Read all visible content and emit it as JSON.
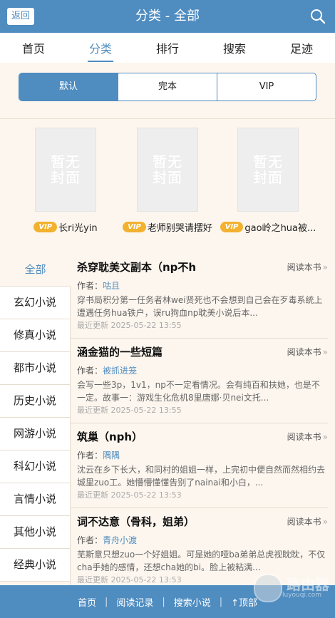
{
  "header": {
    "back_label": "返回",
    "title": "分类 - 全部"
  },
  "nav": {
    "items": [
      "首页",
      "分类",
      "排行",
      "搜索",
      "足迹"
    ],
    "active_index": 1
  },
  "filters": {
    "items": [
      "默认",
      "完本",
      "VIP"
    ],
    "active_index": 0
  },
  "featured": [
    {
      "vip": "VIP",
      "cover_text": [
        "暂无",
        "封面"
      ],
      "title": "长ri光yin"
    },
    {
      "vip": "VIP",
      "cover_text": [
        "暂无",
        "封面"
      ],
      "title": "老师别哭请摆好"
    },
    {
      "vip": "VIP",
      "cover_text": [
        "暂无",
        "封面"
      ],
      "title": "gao岭之hua被..."
    }
  ],
  "categories": {
    "items": [
      "全部",
      "玄幻小说",
      "修真小说",
      "都市小说",
      "历史小说",
      "网游小说",
      "科幻小说",
      "言情小说",
      "其他小说",
      "经典小说"
    ],
    "active_index": 0
  },
  "books": [
    {
      "title": "杀穿耽美文副本（np不h",
      "read_label": "阅读本书",
      "author_label": "作者：",
      "author": "咕且",
      "desc": "穿书局积分第一任务者林wei贤死也不会想到自己会在歹毒系统上遭遇任务hua铁户，误ru狗血np耽美小说后本...",
      "updated_label": "最近更新",
      "updated": "2025-05-22 13:55"
    },
    {
      "title": "涵金猫的一些短篇",
      "read_label": "阅读本书",
      "author_label": "作者：",
      "author": "被抓进笼",
      "desc": "会写一些3p，1v1，np不一定看情况。会有纯百和扶她，也是不一定。故事一：游戏生化危机8里唐娜·贝nei文托...",
      "updated_label": "最近更新",
      "updated": "2025-05-22 13:55"
    },
    {
      "title": "筑巢（nph）",
      "read_label": "阅读本书",
      "author_label": "作者：",
      "author": "隅隅",
      "desc": "沈云在乡下长大，和同村的姐姐一样，上完初中便自然而然相约去城里zuo工。她懵懵懂懂告别了nainai和小白，...",
      "updated_label": "最近更新",
      "updated": "2025-05-22 13:53"
    },
    {
      "title": "词不达意（骨科，姐弟）",
      "read_label": "阅读本书",
      "author_label": "作者：",
      "author": "青舟小渡",
      "desc": "芜斯意只想zuo一个好姐姐。可是她的哑ba弟弟总虎视眈眈，不仅cha手她的感情，还想cha她的bi。脸上被粘满...",
      "updated_label": "最近更新",
      "updated": "2025-05-22 13:53"
    }
  ],
  "footer": {
    "links": [
      "首页",
      "阅读记录",
      "搜索小说",
      "↑顶部"
    ]
  },
  "watermark": {
    "text": "路由器",
    "sub": "luyouqi.com"
  },
  "colors": {
    "brand": "#4f8cc0",
    "background": "#fdf6ee",
    "vip": "#f2b12f"
  }
}
